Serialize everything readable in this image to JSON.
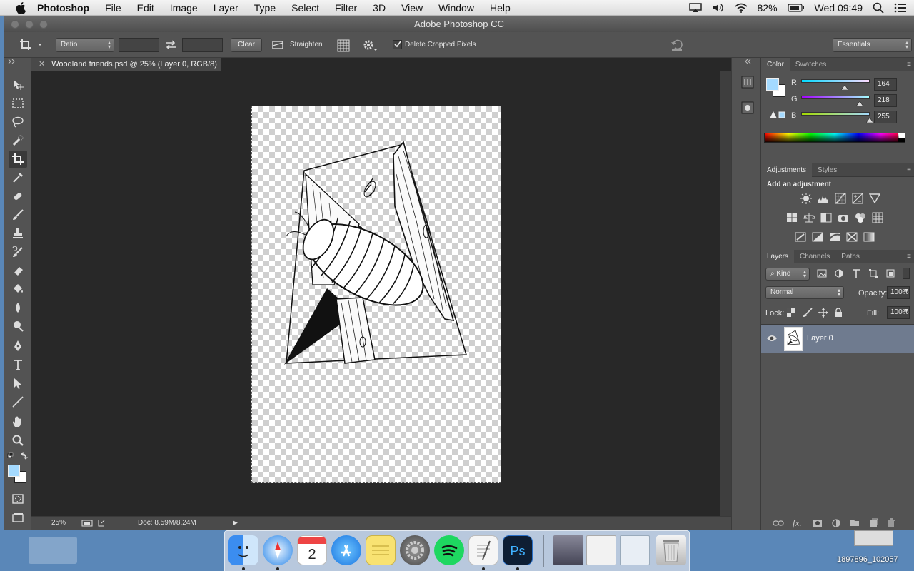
{
  "menubar": {
    "app_name": "Photoshop",
    "items": [
      "File",
      "Edit",
      "Image",
      "Layer",
      "Type",
      "Select",
      "Filter",
      "3D",
      "View",
      "Window",
      "Help"
    ],
    "battery": "82%",
    "clock": "Wed 09:49"
  },
  "window": {
    "title": "Adobe Photoshop CC"
  },
  "options_bar": {
    "ratio_select": "Ratio",
    "clear_button": "Clear",
    "straighten_label": "Straighten",
    "delete_cropped_label": "Delete Cropped Pixels",
    "delete_cropped_checked": true,
    "workspace_select": "Essentials"
  },
  "document": {
    "tab_title": "Woodland friends.psd @ 25% (Layer 0, RGB/8)",
    "zoom": "25%",
    "doc_size": "Doc: 8.59M/8.24M"
  },
  "color_panel": {
    "tabs": [
      "Color",
      "Swatches"
    ],
    "foreground_hex": "#a4daff",
    "channels": [
      {
        "label": "R",
        "value": "164",
        "fraction": 0.64
      },
      {
        "label": "G",
        "value": "218",
        "fraction": 0.855
      },
      {
        "label": "B",
        "value": "255",
        "fraction": 1.0
      }
    ]
  },
  "adjustments_panel": {
    "tabs": [
      "Adjustments",
      "Styles"
    ],
    "heading": "Add an adjustment"
  },
  "layers_panel": {
    "tabs": [
      "Layers",
      "Channels",
      "Paths"
    ],
    "kind_filter": "Kind",
    "blend_mode": "Normal",
    "opacity_label": "Opacity:",
    "opacity_value": "100%",
    "lock_label": "Lock:",
    "fill_label": "Fill:",
    "fill_value": "100%",
    "layers": [
      {
        "name": "Layer 0",
        "visible": true,
        "selected": true
      }
    ]
  },
  "desktop": {
    "file_label": "1897896_102057"
  }
}
